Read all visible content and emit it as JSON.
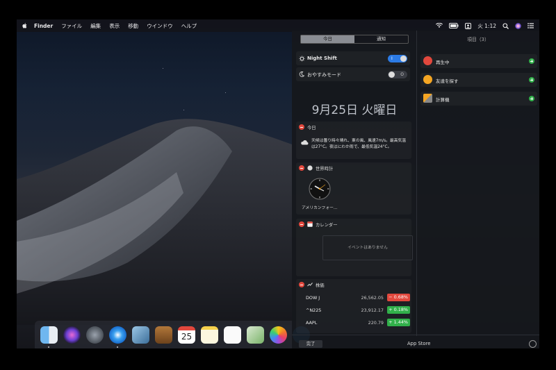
{
  "menubar": {
    "app_name": "Finder",
    "menus": [
      "ファイル",
      "編集",
      "表示",
      "移動",
      "ウインドウ",
      "ヘルプ"
    ],
    "clock": "火 1:12"
  },
  "notification_center": {
    "tabs": {
      "today": "今日",
      "notifications": "通知"
    },
    "night_shift": {
      "label": "Night Shift",
      "state": "I"
    },
    "do_not_disturb": {
      "label": "おやすみモード",
      "state": "O"
    },
    "date": "9月25日 火曜日",
    "today_widget": {
      "title": "今日",
      "forecast": "天候は曇り時々晴れ、東の風、風速7m/s。最高気温は27°C。夜はにわか雨で、最低気温24°C。"
    },
    "world_clock": {
      "title": "世界時計",
      "city": "アメリカンフォー..."
    },
    "calendar": {
      "title": "カレンダー",
      "empty": "イベントはありません"
    },
    "stocks": {
      "title": "株価",
      "rows": [
        {
          "symbol": "DOW J",
          "price": "26,562.05",
          "change": "− 0.68%",
          "dir": "down"
        },
        {
          "symbol": "^N225",
          "price": "23,912.17",
          "change": "+ 0.18%",
          "dir": "up"
        },
        {
          "symbol": "AAPL",
          "price": "220.79",
          "change": "+ 1.44%",
          "dir": "up"
        }
      ]
    },
    "edit_panel": {
      "header": "項目（3）",
      "items": [
        "再生中",
        "友達を探す",
        "計算機"
      ]
    },
    "footer": {
      "done": "完了",
      "app_store": "App Store"
    }
  },
  "colors": {
    "accent": "#2c7be5",
    "down": "#e2483d",
    "up": "#31b04a"
  }
}
